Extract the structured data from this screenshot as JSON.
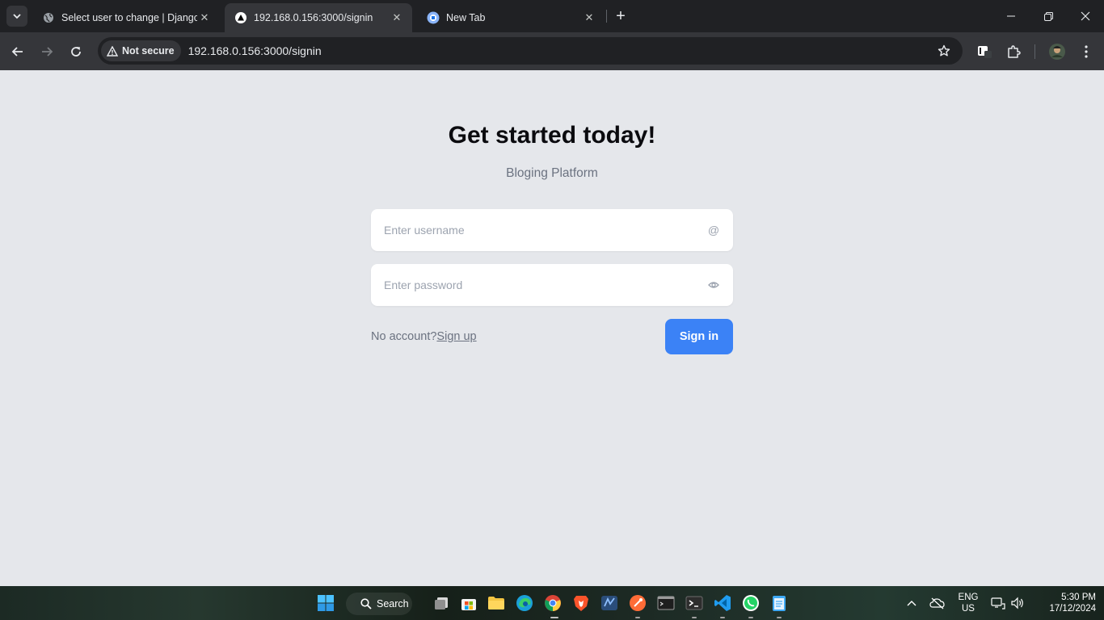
{
  "browser": {
    "tabs": [
      {
        "title": "Select user to change | Django site admin",
        "active": false
      },
      {
        "title": "192.168.0.156:3000/signin",
        "active": true
      },
      {
        "title": "New Tab",
        "active": false
      }
    ],
    "security_label": "Not secure",
    "url": "192.168.0.156:3000/signin"
  },
  "page": {
    "headline": "Get started today!",
    "subtitle": "Bloging Platform",
    "username_placeholder": "Enter username",
    "username_icon": "@",
    "password_placeholder": "Enter password",
    "no_account_text": "No account?",
    "signup_link": "Sign up",
    "signin_button": "Sign in",
    "accent_color": "#3b82f6"
  },
  "taskbar": {
    "search_label": "Search",
    "language_line1": "ENG",
    "language_line2": "US",
    "time": "5:30 PM",
    "date": "17/12/2024"
  }
}
